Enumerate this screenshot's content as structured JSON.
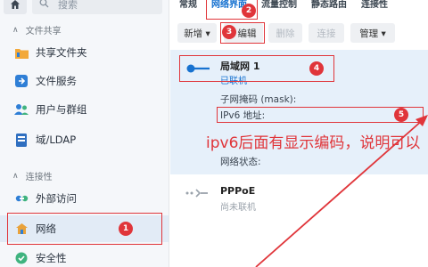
{
  "sidebar": {
    "search_placeholder": "搜索",
    "section1": "文件共享",
    "section2": "连接性",
    "items": [
      {
        "label": "共享文件夹"
      },
      {
        "label": "文件服务"
      },
      {
        "label": "用户与群组"
      },
      {
        "label": "域/LDAP"
      },
      {
        "label": "外部访问"
      },
      {
        "label": "网络"
      },
      {
        "label": "安全性"
      }
    ]
  },
  "tabs": [
    "常规",
    "网络界面",
    "流量控制",
    "静态路由",
    "连接性"
  ],
  "toolbar": {
    "new": "新增 ▾",
    "edit": "编辑",
    "delete": "删除",
    "connect": "连接",
    "manage": "管理 ▾"
  },
  "lan": {
    "title": "局域网 1",
    "status": "已联机",
    "mask_label": "子网掩码 (mask):",
    "ipv6_label": "IPv6 地址:",
    "net_status_label": "网络状态:"
  },
  "pppoe": {
    "title": "PPPoE",
    "status": "尚未联机"
  },
  "annotation": {
    "note": "ipv6后面有显示编码，说明可以",
    "badges": [
      "1",
      "2",
      "3",
      "4",
      "5"
    ]
  },
  "colors": {
    "accent": "#1772d0",
    "annotation_red": "#e0353a",
    "selected_panel": "#e6f0fa"
  }
}
